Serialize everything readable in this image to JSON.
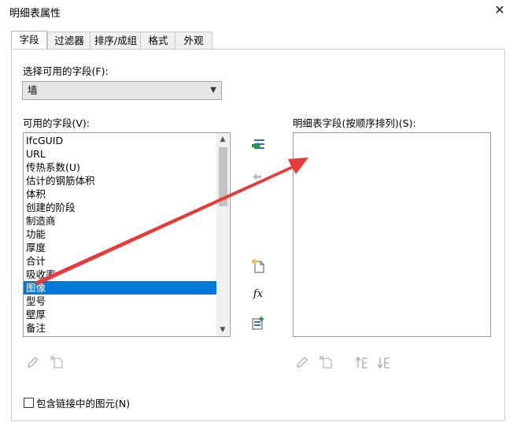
{
  "window": {
    "title": "明细表属性",
    "close_label": "✕"
  },
  "tabs": [
    {
      "label": "字段",
      "active": true
    },
    {
      "label": "过滤器",
      "active": false
    },
    {
      "label": "排序/成组",
      "active": false
    },
    {
      "label": "格式",
      "active": false
    },
    {
      "label": "外观",
      "active": false
    }
  ],
  "category": {
    "label": "选择可用的字段(F):",
    "value": "墙"
  },
  "available": {
    "label": "可用的字段(V):",
    "items": [
      "IfcGUID",
      "URL",
      "传热系数(U)",
      "估计的钢筋体积",
      "体积",
      "创建的阶段",
      "制造商",
      "功能",
      "厚度",
      "合计",
      "吸收率",
      "图像",
      "型号",
      "壁厚",
      "备注"
    ],
    "selected_index": 11
  },
  "scheduled": {
    "label": "明细表字段(按顺序排列)(S):",
    "items": []
  },
  "middle_buttons": [
    "add-parameter-icon",
    "remove-parameter-icon",
    "new-parameter-icon",
    "calculated-value-icon",
    "combine-parameters-icon"
  ],
  "bottom_left_buttons": [
    "edit-icon",
    "delete-icon"
  ],
  "bottom_right_buttons": [
    "edit-icon",
    "delete-icon",
    "move-up-icon",
    "move-down-icon"
  ],
  "include_linked": {
    "label": "包含链接中的图元(N)",
    "checked": false
  },
  "colors": {
    "selection": "#0078d7",
    "annotation_arrow": "#e83a3a",
    "add_arrow": "#1e9b3a"
  }
}
